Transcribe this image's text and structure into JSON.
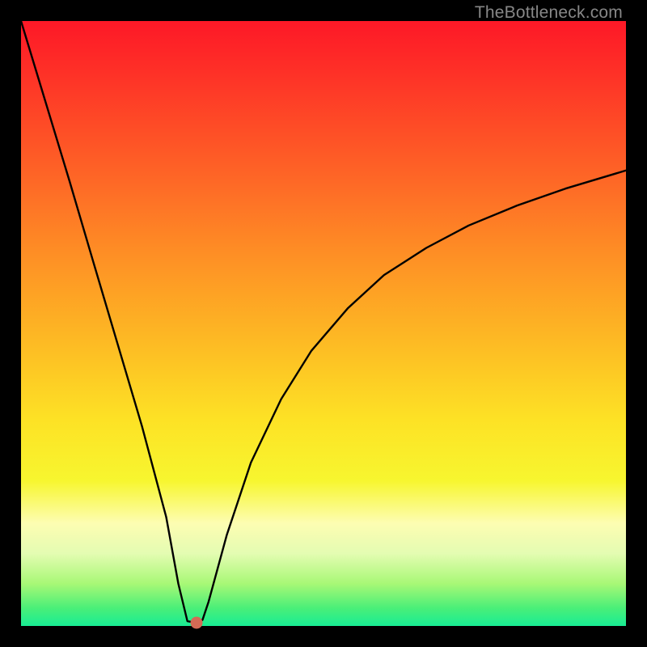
{
  "watermark": "TheBottleneck.com",
  "chart_data": {
    "type": "line",
    "title": "",
    "xlabel": "",
    "ylabel": "",
    "xlim": [
      0,
      100
    ],
    "ylim": [
      0,
      100
    ],
    "series": [
      {
        "name": "curve",
        "x": [
          0.0,
          4.0,
          8.0,
          12.0,
          16.0,
          20.0,
          24.0,
          26.0,
          27.5,
          29.0,
          30.0,
          31.0,
          34.0,
          38.0,
          43.0,
          48.0,
          54.0,
          60.0,
          67.0,
          74.0,
          82.0,
          90.0,
          100.0
        ],
        "y": [
          100.0,
          86.8,
          73.6,
          60.0,
          46.5,
          33.0,
          18.0,
          7.0,
          0.8,
          0.5,
          1.0,
          4.0,
          15.0,
          27.0,
          37.5,
          45.5,
          52.5,
          58.0,
          62.5,
          66.2,
          69.5,
          72.3,
          75.3
        ]
      }
    ],
    "marker": {
      "x": 29.0,
      "y": 0.5,
      "color": "#d46a55"
    },
    "background_gradient": [
      "#fd1827",
      "#fe2f27",
      "#fe6326",
      "#fe8d25",
      "#fdb724",
      "#fde225",
      "#f7f62f",
      "#fdfdb2",
      "#e4fcb2",
      "#a8f876",
      "#4bef78",
      "#18ec94"
    ]
  }
}
